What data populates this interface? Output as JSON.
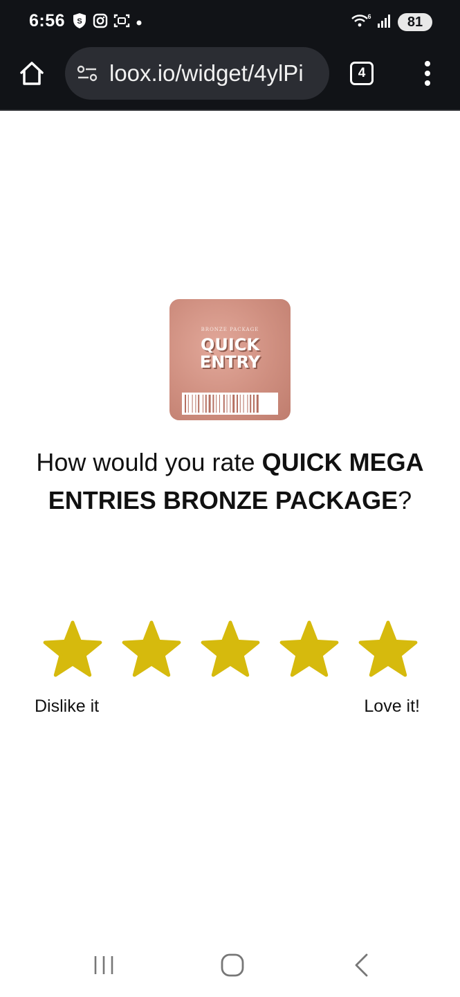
{
  "status_bar": {
    "time": "6:56",
    "battery": "81",
    "left_icons": [
      "shield-s-icon",
      "instagram-icon",
      "screenshot-icon",
      "dot-icon"
    ],
    "right_icons": [
      "wifi-6-icon",
      "signal-icon",
      "battery-icon"
    ]
  },
  "browser": {
    "url": "loox.io/widget/4ylPi",
    "tab_count": "4",
    "icons": [
      "home-icon",
      "site-settings-icon",
      "tab-switcher-icon",
      "more-vert-icon"
    ]
  },
  "product": {
    "image_label_small": "BRONZE PACKAGE",
    "image_title_line1": "QUICK",
    "image_title_line2": "ENTRY"
  },
  "question": {
    "prefix": "How would you rate ",
    "product_name": "QUICK MEGA ENTRIES BRONZE PACKAGE",
    "suffix": "?"
  },
  "rating": {
    "max": 5,
    "star_color": "#d6ba0d",
    "low_label": "Dislike it",
    "high_label": "Love it!"
  },
  "nav_bar": {
    "icons": [
      "recents-icon",
      "home-icon",
      "back-icon"
    ]
  }
}
